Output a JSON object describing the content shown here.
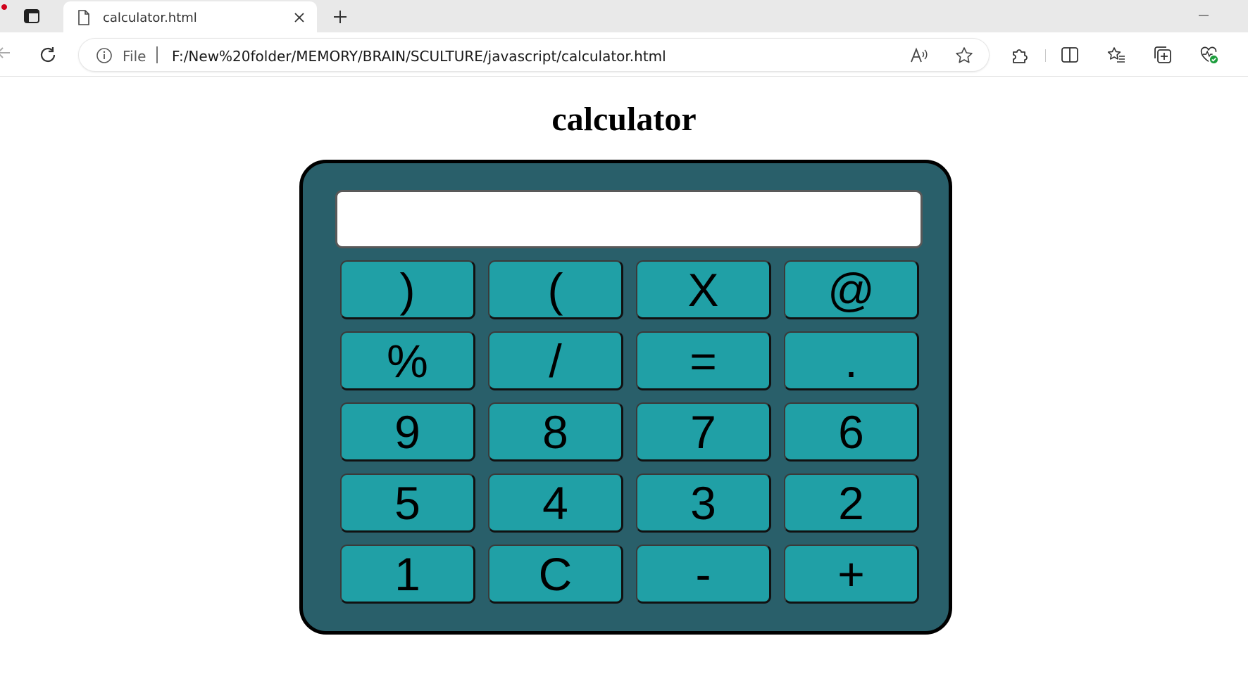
{
  "browser": {
    "tab_title": "calculator.html",
    "site_info_label": "File",
    "url": "F:/New%20folder/MEMORY/BRAIN/SCULTURE/javascript/calculator.html",
    "icons": {
      "tab_actions": "tab-actions-icon",
      "tab_page": "page-icon",
      "tab_close": "close-icon",
      "new_tab": "plus-icon",
      "minimize": "minimize-icon",
      "back": "back-arrow-icon",
      "refresh": "refresh-icon",
      "site_info": "info-icon",
      "read_aloud": "read-aloud-icon",
      "favorite": "star-icon",
      "extensions": "puzzle-icon",
      "split_screen": "split-screen-icon",
      "favorites": "favorites-icon",
      "collections": "collections-icon",
      "browser_essentials": "heart-pulse-icon"
    }
  },
  "page": {
    "title": "calculator"
  },
  "calculator": {
    "display_value": "",
    "keys": [
      ")",
      "(",
      "X",
      "@",
      "%",
      "/",
      "=",
      ".",
      "9",
      "8",
      "7",
      "6",
      "5",
      "4",
      "3",
      "2",
      "1",
      "C",
      "-",
      "+"
    ],
    "colors": {
      "body": "#295f6a",
      "key": "#20a0a6",
      "border": "#000000"
    }
  }
}
